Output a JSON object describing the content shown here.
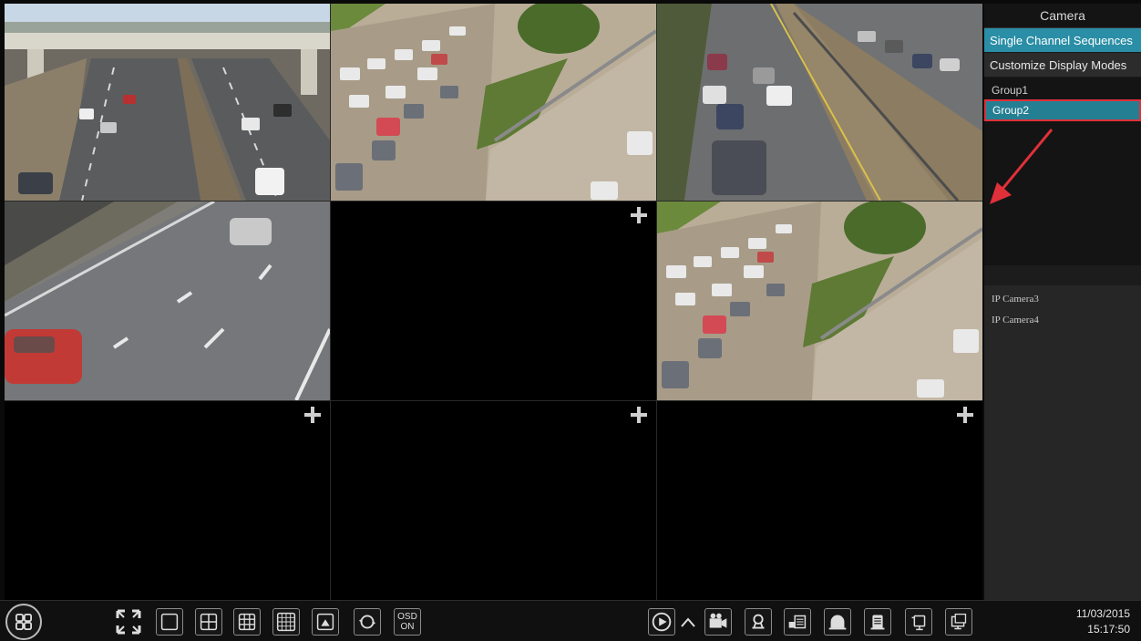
{
  "sidebar": {
    "title": "Camera",
    "modes": [
      {
        "label": "Single Channel Sequences",
        "active": true
      },
      {
        "label": "Customize Display Modes",
        "active": false
      }
    ],
    "groups": [
      {
        "label": "Group1",
        "selected": false
      },
      {
        "label": "Group2",
        "selected": true
      }
    ],
    "cameras": [
      "IP Camera3",
      "IP Camera4"
    ]
  },
  "grid": {
    "tiles": [
      {
        "state": "live",
        "scene": "overpass-highway"
      },
      {
        "state": "live",
        "scene": "dense-traffic"
      },
      {
        "state": "live",
        "scene": "highway-cars"
      },
      {
        "state": "live",
        "scene": "close-up-road"
      },
      {
        "state": "empty",
        "add_icon": "plus-icon"
      },
      {
        "state": "live",
        "scene": "dense-traffic",
        "selected": true
      },
      {
        "state": "empty",
        "add_icon": "plus-icon"
      },
      {
        "state": "empty",
        "add_icon": "plus-icon"
      },
      {
        "state": "empty",
        "add_icon": "plus-icon"
      }
    ]
  },
  "toolbar": {
    "left_icons": [
      "start-menu-icon",
      "fullscreen-icon",
      "layout-1-icon",
      "layout-4-icon",
      "layout-9-icon",
      "layout-16-icon",
      "custom-layout-icon",
      "sequence-icon"
    ],
    "osd_label": "OSD\nON",
    "right_icons": [
      "playback-icon",
      "expand-up-icon",
      "record-icon",
      "manual-alarm-icon",
      "snapshot-icon",
      "disarm-icon",
      "record-status-icon",
      "network-icon",
      "display-settings-icon"
    ],
    "date": "11/03/2015",
    "time": "15:17:50"
  },
  "colors": {
    "accent": "#2a8ea6",
    "highlight_border": "#e0303a",
    "background": "#0a0a0a"
  }
}
